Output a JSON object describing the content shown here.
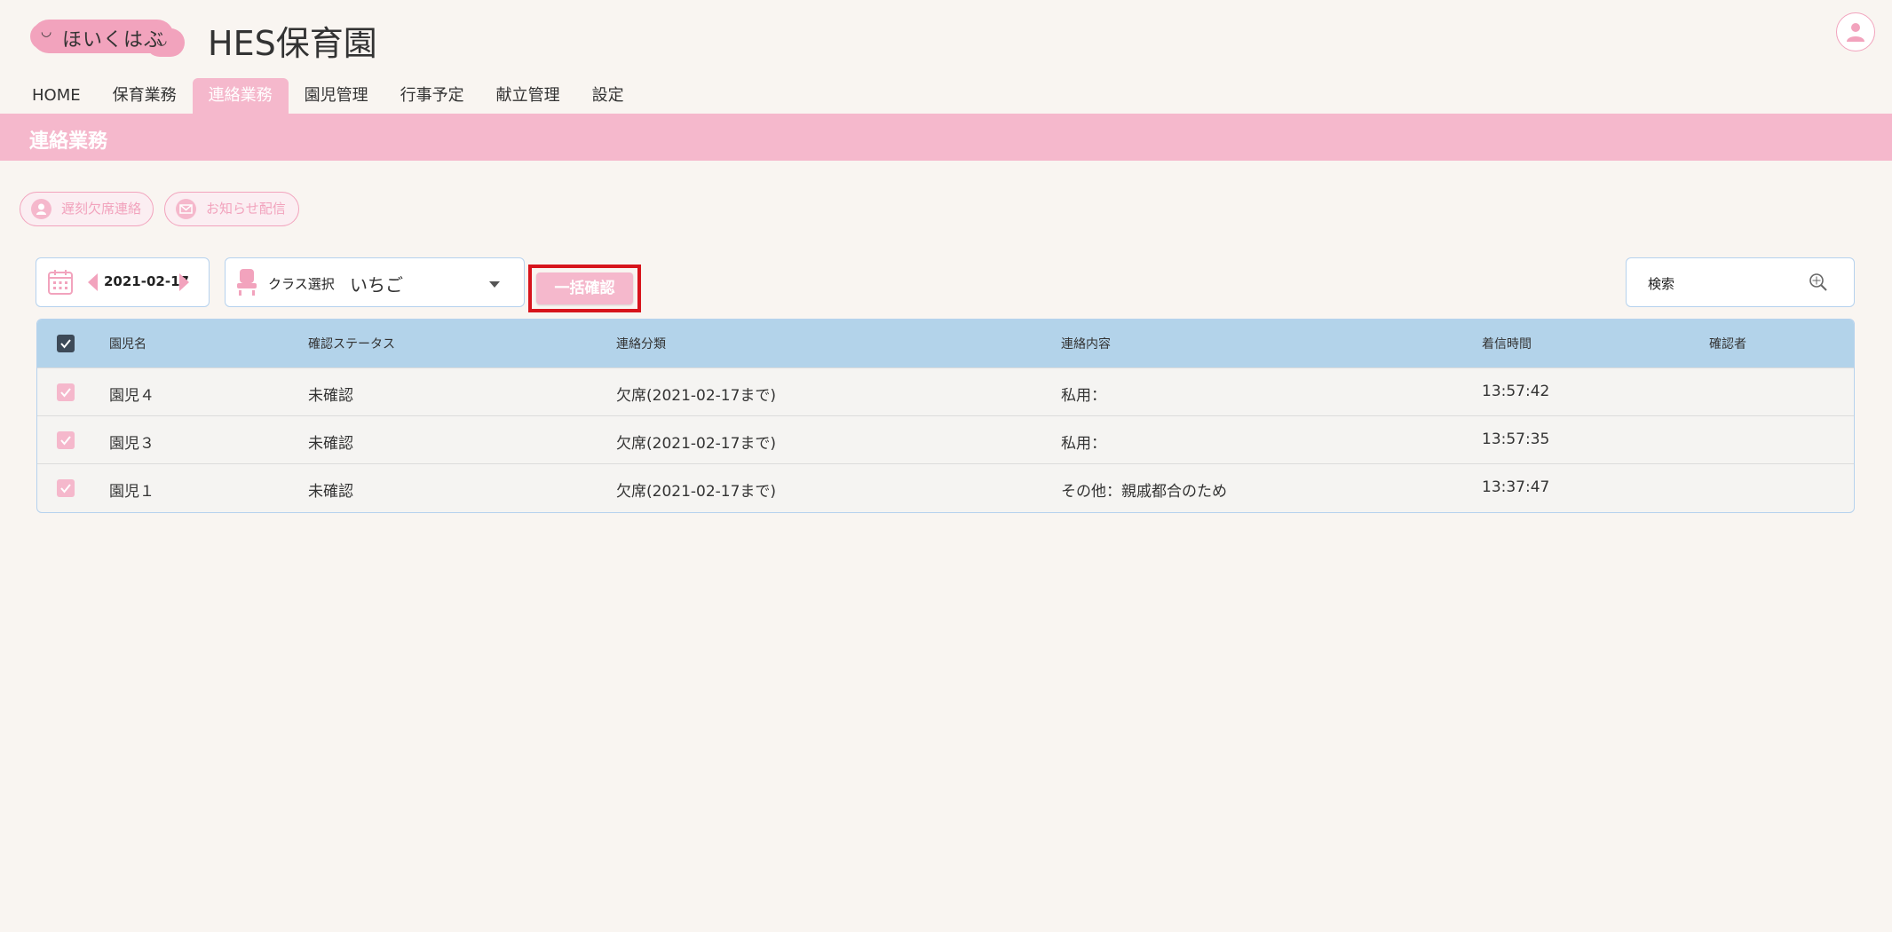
{
  "brand": {
    "logo_text": "ほいくはぶ",
    "site_title": "HES保育園"
  },
  "nav": {
    "items": [
      {
        "label": "HOME"
      },
      {
        "label": "保育業務"
      },
      {
        "label": "連絡業務",
        "active": true
      },
      {
        "label": "園児管理"
      },
      {
        "label": "行事予定"
      },
      {
        "label": "献立管理"
      },
      {
        "label": "設定"
      }
    ]
  },
  "page": {
    "title": "連絡業務"
  },
  "actions": {
    "absence_label": "遅刻欠席連絡",
    "notice_label": "お知らせ配信"
  },
  "filters": {
    "date": "2021-02-17",
    "class_label": "クラス選択",
    "class_value": "いちご",
    "bulk_confirm_label": "一括確認",
    "search_placeholder": "検索"
  },
  "table": {
    "headers": {
      "name": "園児名",
      "status": "確認ステータス",
      "category": "連絡分類",
      "content": "連絡内容",
      "time": "着信時間",
      "confirmer": "確認者"
    },
    "rows": [
      {
        "name": "園児４",
        "status": "未確認",
        "category": "欠席(2021-02-17まで)",
        "content": "私用：",
        "time": "13:57:42",
        "confirmer": ""
      },
      {
        "name": "園児３",
        "status": "未確認",
        "category": "欠席(2021-02-17まで)",
        "content": "私用：",
        "time": "13:57:35",
        "confirmer": ""
      },
      {
        "name": "園児１",
        "status": "未確認",
        "category": "欠席(2021-02-17まで)",
        "content": "その他：親戚都合のため",
        "time": "13:37:47",
        "confirmer": ""
      }
    ]
  },
  "colors": {
    "accent_pink": "#f5b8cc",
    "header_blue": "#b3d3ea",
    "highlight_red": "#d7141c",
    "background": "#f9f5f1"
  }
}
